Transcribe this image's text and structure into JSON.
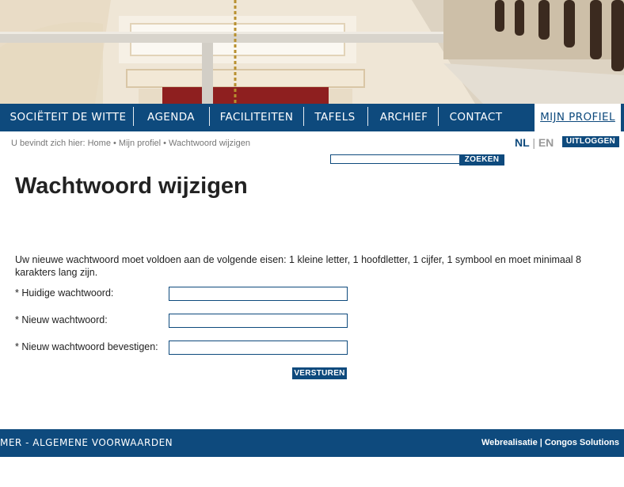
{
  "nav": {
    "items": [
      "SOCIËTEIT DE WITTE",
      "AGENDA",
      "FACILITEITEN",
      "TAFELS",
      "ARCHIEF",
      "CONTACT"
    ],
    "active": "MIJN PROFIEL"
  },
  "breadcrumb": "U bevindt zich hier: Home • Mijn profiel • Wachtwoord wijzigen",
  "lang": {
    "nl": "NL",
    "separator": "|",
    "en": "EN"
  },
  "logout_label": "UITLOGGEN",
  "search": {
    "value": "",
    "button": "ZOEKEN"
  },
  "page_title": "Wachtwoord wijzigen",
  "intro": "Uw nieuwe wachtwoord moet voldoen aan de volgende eisen: 1 kleine letter, 1 hoofdletter, 1 cijfer, 1 symbool en moet minimaal 8 karakters lang zijn.",
  "form": {
    "current_label": "* Huidige wachtwoord:",
    "new_label": "* Nieuw wachtwoord:",
    "confirm_label": "* Nieuw wachtwoord bevestigen:",
    "submit": "VERSTUREN"
  },
  "footer": {
    "left": "MER - ALGEMENE VOORWAARDEN",
    "right": "Webrealisatie | Congos Solutions"
  },
  "colors": {
    "brand": "#0e4a7d"
  }
}
